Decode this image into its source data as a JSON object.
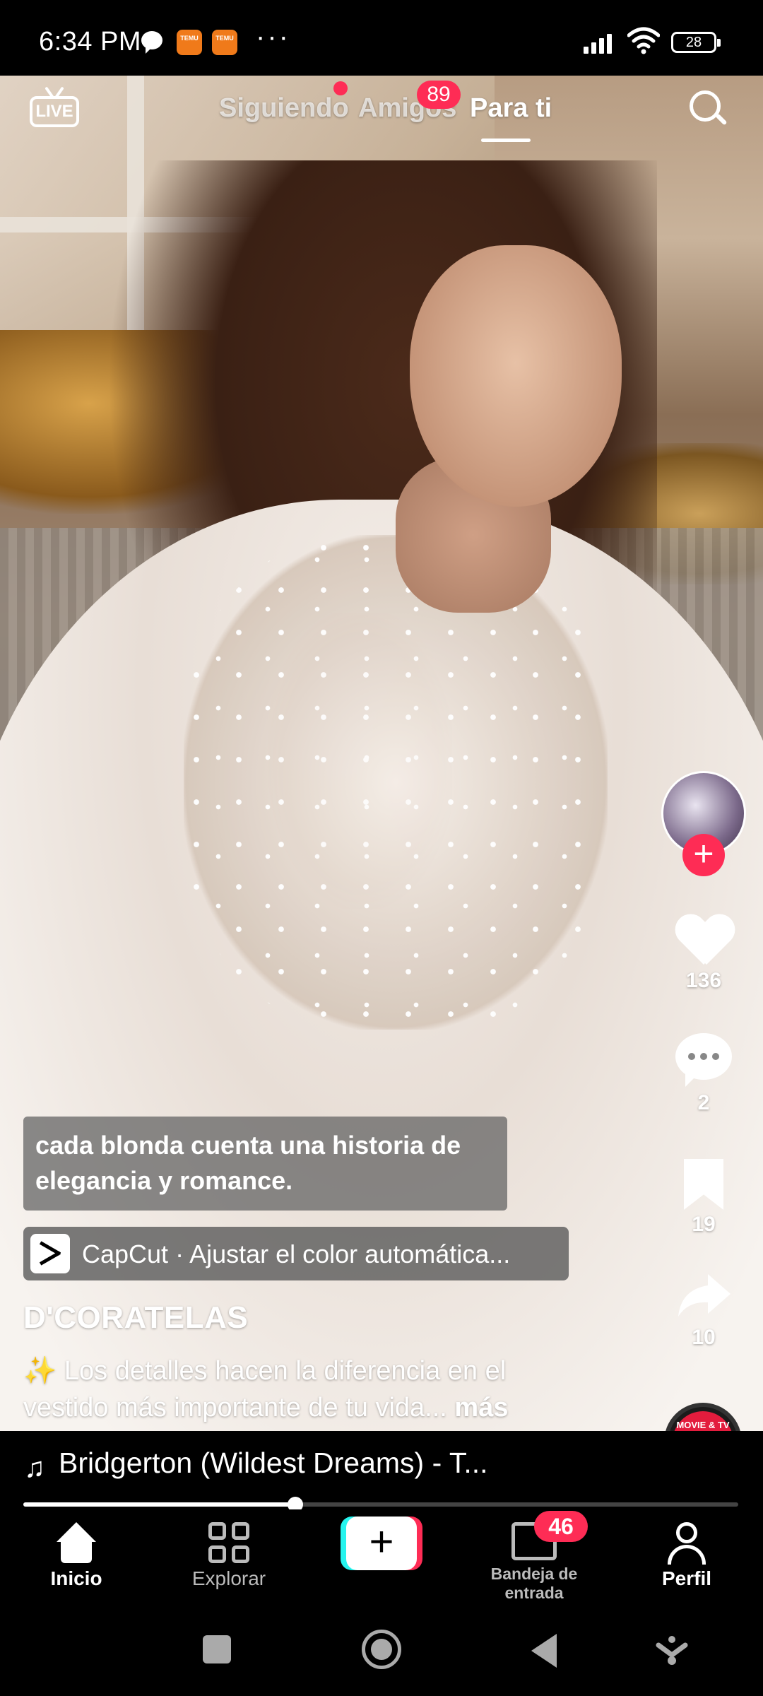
{
  "status_bar": {
    "time": "6:34 PM",
    "temu_label": "TEMU",
    "battery": "28"
  },
  "top_tabs": {
    "live_label": "LIVE",
    "tabs": [
      {
        "label": "Siguiendo"
      },
      {
        "label": "Amigos"
      },
      {
        "label": "Para ti",
        "active": true
      }
    ],
    "friends_badge": "89"
  },
  "video": {
    "caption": "cada blonda cuenta una historia de elegancia y romance.",
    "capcut_link": "CapCut · Ajustar el color automática...",
    "author": "D'CORATELAS",
    "description": "✨ Los detalles hacen la diferencia en el vestido más importante de tu vida...",
    "more_label": "más",
    "progress": 0.38
  },
  "right_rail": {
    "likes": "136",
    "comments": "2",
    "saves": "19",
    "shares": "10",
    "disc_text": "MOVIE & TV SOUNDTRACKS"
  },
  "music": {
    "note_icon": "music-note-icon",
    "title": "Bridgerton (Wildest Dreams) - T..."
  },
  "bottom_nav": {
    "items": [
      {
        "label": "Inicio",
        "icon": "home-icon",
        "active": true
      },
      {
        "label": "Explorar",
        "icon": "explore-icon"
      },
      {
        "label": "",
        "icon": "create-plus-icon"
      },
      {
        "label": "Bandeja de entrada",
        "icon": "inbox-icon"
      },
      {
        "label": "Perfil",
        "icon": "profile-icon"
      }
    ],
    "inbox_badge": "46"
  },
  "colors": {
    "accent": "#fe2c55",
    "cyan": "#25f4ee"
  }
}
